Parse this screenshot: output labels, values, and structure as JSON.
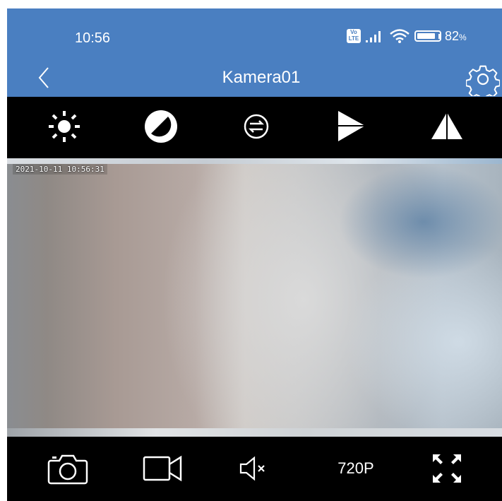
{
  "status_bar": {
    "time": "10:56",
    "volte": "Vo\nLTE",
    "battery_percent": "82",
    "battery_unit": "%",
    "battery_level": 0.82
  },
  "header": {
    "title": "Kamera01"
  },
  "toolbar": {
    "icons": [
      "brightness-icon",
      "contrast-icon",
      "flip-icon",
      "play-icon",
      "mirror-icon"
    ]
  },
  "video": {
    "timestamp": "2021-10-11 10:56:31"
  },
  "bottom_bar": {
    "resolution": "720P",
    "icons": [
      "snapshot-icon",
      "record-icon",
      "mute-icon",
      "fullscreen-icon"
    ]
  },
  "colors": {
    "header_bg": "#4a7fc1",
    "bar_bg": "#000000",
    "icon": "#ffffff"
  }
}
